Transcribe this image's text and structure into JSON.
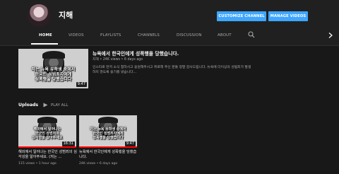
{
  "channel": {
    "name": "지해"
  },
  "buttons": {
    "customize": "CUSTOMIZE CHANNEL",
    "manage": "MANAGE VIDEOS"
  },
  "tabs": [
    {
      "label": "HOME",
      "active": true
    },
    {
      "label": "VIDEOS"
    },
    {
      "label": "PLAYLISTS"
    },
    {
      "label": "CHANNELS"
    },
    {
      "label": "DISCUSSION"
    },
    {
      "label": "ABOUT"
    }
  ],
  "featured": {
    "title": "뉴욕에서 한국인에게 성폭행을 당했습니다.",
    "meta": "지해 • 24K views • 6 days ago",
    "description": "인스타로 먼저 소식 접하시고 응원해주시고 위로해 주신 분들 정말 감사드립니다. 뉴욕에 더이상의 성범죄가 발생하지 않도록 용기를 냈습니다...",
    "duration": "9:47",
    "overlay": "저는 뉴욕 유학생 중에서\n한국인 성범죄자에게\n성폭행을 당했습니다",
    "progress": 0.4
  },
  "uploads": {
    "label": "Uploads",
    "play_all": "PLAY ALL",
    "videos": [
      {
        "title": "해외에서 일어나는 한국인 성범죄의 심각성을 알아주세요. (저는 ...",
        "meta": "115 views • 1 hour ago",
        "duration": "16:31",
        "overlay": "해외에서 일어나는\n한국인 성범죄의\n심각성을 알아주세요",
        "progress": 1.0
      },
      {
        "title": "뉴욕에서 한국인에게 성폭행을 당했습니다.",
        "meta": "24K views • 6 days ago",
        "duration": "9:47",
        "overlay": "저는 뉴욕 유학생 중에서\n한국인 성범죄자에게\n성폭행을 당했습니다",
        "progress": 1.0
      }
    ]
  },
  "colors": {
    "accent": "#3ea6ff",
    "background": "#181818",
    "header": "#202020",
    "progress": "#ff0000"
  },
  "icons": {
    "search": "search-icon",
    "next": "chevron-right-icon",
    "play_all": "play-all-icon"
  }
}
